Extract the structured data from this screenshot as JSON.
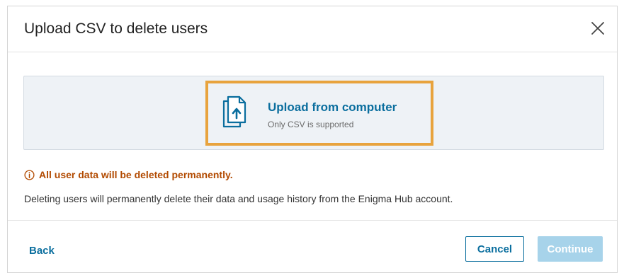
{
  "dialog": {
    "title": "Upload CSV to delete users",
    "close_icon": "close-icon"
  },
  "upload": {
    "label": "Upload from computer",
    "hint": "Only CSV is supported",
    "icon": "file-upload-icon",
    "highlight_color": "#e8a33d"
  },
  "warning": {
    "icon": "info-circle-icon",
    "text": "All user data will be deleted permanently.",
    "color": "#b24a00"
  },
  "description": "Deleting users will permanently delete their data and usage history from the Enigma Hub account.",
  "footer": {
    "back_label": "Back",
    "cancel_label": "Cancel",
    "continue_label": "Continue",
    "continue_disabled": true
  },
  "colors": {
    "accent": "#0a6e9e",
    "disabled_button": "#a7d3ea",
    "dropzone_background": "#eef2f6"
  }
}
